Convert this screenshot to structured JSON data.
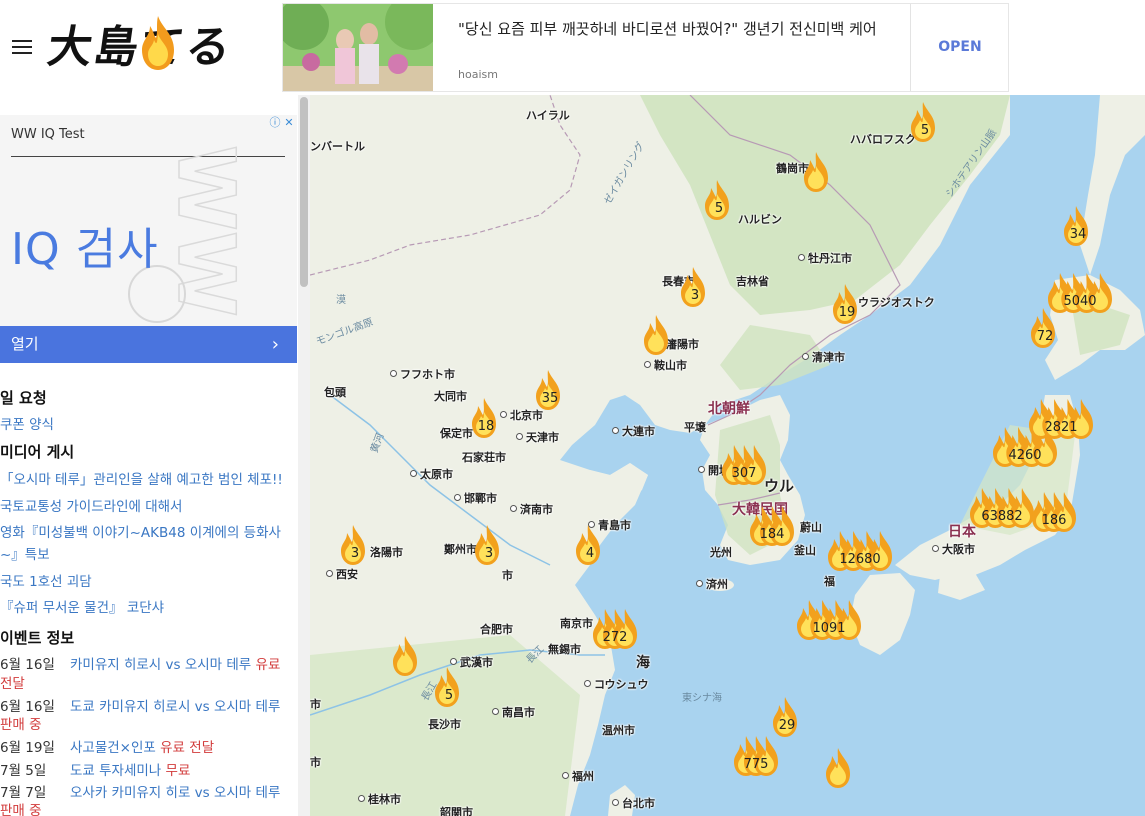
{
  "header": {
    "logo_text": "大島てる",
    "top_ad": {
      "title": "\"당신 요즘 피부 깨끗하네 바디로션 바꿨어?\" 갱년기 전신미백 케어",
      "source": "hoaism",
      "cta": "OPEN"
    }
  },
  "sidebar": {
    "ad": {
      "advertiser": "WW IQ Test",
      "headline": "IQ 검사",
      "watermark": "WW",
      "adchoice_info": "ⓘ",
      "adchoice_close": "✕",
      "button": "열기",
      "button_chevron": "›"
    },
    "section1": {
      "heading": "일 요청",
      "links": [
        "쿠폰 양식"
      ]
    },
    "section2": {
      "heading": "미디어 게시",
      "links": [
        "「오시마 테루」관리인을 살해 예고한 범인 체포!!",
        "국토교통성 가이드라인에 대해서",
        "영화『미성불백 이야기~AKB48 이계에의 등화사",
        "~』특보",
        "국도 1호선 괴담",
        "『슈퍼 무서운 물건』 코단샤"
      ]
    },
    "section3": {
      "heading": "이벤트 정보",
      "events": [
        {
          "date": "6월 16일",
          "title": "카미유지 히로시 vs 오시마 테루",
          "tag": "유료",
          "cont": "전달"
        },
        {
          "date": "6월 16일",
          "title": "도쿄 카미유지 히로시 vs 오시마 테루",
          "tag": "",
          "cont": "판매 중"
        },
        {
          "date": "6월 19일",
          "title": "사고물건×인포",
          "tag": "유료 전달",
          "cont": ""
        },
        {
          "date": "7월 5일",
          "title": "도쿄 투자세미나",
          "tag": "무료",
          "cont": ""
        },
        {
          "date": "7월 7일",
          "title": "오사카 카미유지 히로 vs 오시마 테루",
          "tag": "",
          "cont": "판매 중"
        }
      ]
    }
  },
  "map": {
    "colors": {
      "sea": "#a9d3ef",
      "land": "#eef0e6",
      "forest": "#cfe3bf",
      "border": "#b79ab5"
    },
    "labels": [
      {
        "t": "ハイラル"
      },
      {
        "t": "ハバロフスク"
      },
      {
        "t": "ンバートル"
      },
      {
        "t": "鶴崗市"
      },
      {
        "t": "ハルビン"
      },
      {
        "t": "牡丹江市"
      },
      {
        "t": "長春市"
      },
      {
        "t": "吉林省"
      },
      {
        "t": "ウラジオストク"
      },
      {
        "t": "瀋陽市"
      },
      {
        "t": "鞍山市"
      },
      {
        "t": "清津市"
      },
      {
        "t": "フフホト市"
      },
      {
        "t": "包頭"
      },
      {
        "t": "大同市"
      },
      {
        "t": "北京市"
      },
      {
        "t": "保定市"
      },
      {
        "t": "天津市"
      },
      {
        "t": "大連市"
      },
      {
        "t": "平壌"
      },
      {
        "t": "北朝鮮"
      },
      {
        "t": "石家荘市"
      },
      {
        "t": "太原市"
      },
      {
        "t": "邯鄲市"
      },
      {
        "t": "済南市"
      },
      {
        "t": "開城"
      },
      {
        "t": "ウル"
      },
      {
        "t": "大韓民国"
      },
      {
        "t": "青島市"
      },
      {
        "t": "光州"
      },
      {
        "t": "蔚山"
      },
      {
        "t": "釜山"
      },
      {
        "t": "日本"
      },
      {
        "t": "大阪市"
      },
      {
        "t": "洛陽市"
      },
      {
        "t": "鄭州市"
      },
      {
        "t": "西安"
      },
      {
        "t": "市"
      },
      {
        "t": "済州"
      },
      {
        "t": "福"
      },
      {
        "t": "南京市"
      },
      {
        "t": "合肥市"
      },
      {
        "t": "無錫市"
      },
      {
        "t": "海"
      },
      {
        "t": "武漢市"
      },
      {
        "t": "コウシュウ"
      },
      {
        "t": "東シナ海"
      },
      {
        "t": "長沙市"
      },
      {
        "t": "南昌市"
      },
      {
        "t": "温州市"
      },
      {
        "t": "福州"
      },
      {
        "t": "桂林市"
      },
      {
        "t": "台北市"
      },
      {
        "t": "韶関市"
      },
      {
        "t": "市"
      },
      {
        "t": "モンゴル高原"
      },
      {
        "t": "漠"
      },
      {
        "t": "ゼイガンリング"
      },
      {
        "t": "シホテアリン山脈"
      },
      {
        "t": "市"
      },
      {
        "t": "黄河"
      },
      {
        "t": "長江"
      },
      {
        "t": "長江"
      }
    ],
    "markers": [
      {
        "count": "5"
      },
      {
        "count": ""
      },
      {
        "count": "5"
      },
      {
        "count": "34"
      },
      {
        "count": "5040"
      },
      {
        "count": "72"
      },
      {
        "count": "3"
      },
      {
        "count": "19"
      },
      {
        "count": ""
      },
      {
        "count": "35"
      },
      {
        "count": "18"
      },
      {
        "count": "2821"
      },
      {
        "count": "4260"
      },
      {
        "count": "307"
      },
      {
        "count": "63882"
      },
      {
        "count": "186"
      },
      {
        "count": "184"
      },
      {
        "count": "3"
      },
      {
        "count": "3"
      },
      {
        "count": "4"
      },
      {
        "count": "12680"
      },
      {
        "count": "1091"
      },
      {
        "count": "272"
      },
      {
        "count": ""
      },
      {
        "count": "5"
      },
      {
        "count": "29"
      },
      {
        "count": "775"
      },
      {
        "count": ""
      }
    ]
  }
}
